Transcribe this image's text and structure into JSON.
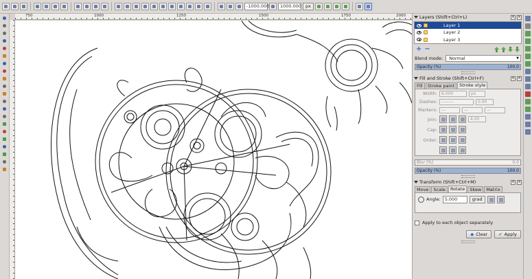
{
  "toolbar": {
    "x_value": "-1000.000",
    "w_value": "1000.000",
    "unit": "px"
  },
  "ruler": {
    "ticks": [
      "750",
      "1000",
      "1250",
      "1500",
      "1750",
      "2000"
    ]
  },
  "layers_panel": {
    "title": "Layers (Shift+Ctrl+L)",
    "layers": [
      "Layer 1",
      "Layer 2",
      "Layer 3"
    ],
    "blend_label": "Blend mode:",
    "blend_value": "Normal",
    "opacity_label": "Opacity (%)",
    "opacity_value": "100.0",
    "opacity_fraction": 1.0
  },
  "fill_stroke_panel": {
    "title": "Fill and Stroke (Shift+Ctrl+F)",
    "tabs": [
      "Fill",
      "Stroke paint",
      "Stroke style"
    ],
    "active_tab": "Stroke style",
    "width_label": "Width:",
    "width_value": "6.000",
    "width_unit": "px",
    "dashes_label": "Dashes:",
    "dashes_value": "0.00",
    "markers_label": "Markers:",
    "markers": [
      "—",
      "—",
      "—"
    ],
    "join_label": "Join:",
    "miter_value": "4.00",
    "cap_label": "Cap:",
    "order_label": "Order:",
    "blur_label": "Blur (%)",
    "blur_value": "0.0",
    "opacity_label": "Opacity (%)",
    "opacity_value": "100.0"
  },
  "transform_panel": {
    "title": "Transform (Shift+Ctrl+M)",
    "tabs": [
      "Move",
      "Scale",
      "Rotate",
      "Skew",
      "Matrix"
    ],
    "active_tab": "Rotate",
    "angle_label": "Angle:",
    "angle_value": "5.000",
    "angle_unit": "grad",
    "apply_each_label": "Apply to each object separately",
    "clear_label": "Clear",
    "apply_label": "Apply"
  }
}
